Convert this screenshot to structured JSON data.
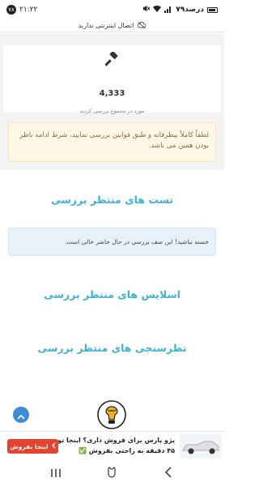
{
  "status_bar": {
    "time": "۲۱:۲۲",
    "notification_count": "۷۸",
    "battery": "۷۹درصد"
  },
  "connection": {
    "offline_text": "اتصال اینترنتی ندارید"
  },
  "stats": {
    "count": "4,333",
    "label": "مورد در مجموع بررسی کردید",
    "icon": "gavel-icon"
  },
  "notice": {
    "text": "لطفاً کاملاً بیطرفانه و طبق قوانین بررسی نمایید، شرط ادامه ناظر بودن همین می باشد."
  },
  "sections": {
    "tests_title": "تست های منتظر بررسی",
    "tests_empty": "خسته نباشید! این صف بررسی در حال حاضر خالی است.",
    "slides_title": "اسلایس های منتظر بررسی",
    "polls_title": "نظرسنجی های منتظر بررسی"
  },
  "ad": {
    "line1": "پژو پارس برای فروش داری؟ اینجا تو",
    "line2": "۴۵ دقیقه به راحتی بفروش ✅",
    "button": "اینجا بفروش",
    "button_color": "#e2442f"
  },
  "colors": {
    "accent": "#3eb3d6",
    "fab": "#3e8cd8",
    "notice_bg": "#fdf8e6",
    "info_bg": "#e6f1fa"
  }
}
